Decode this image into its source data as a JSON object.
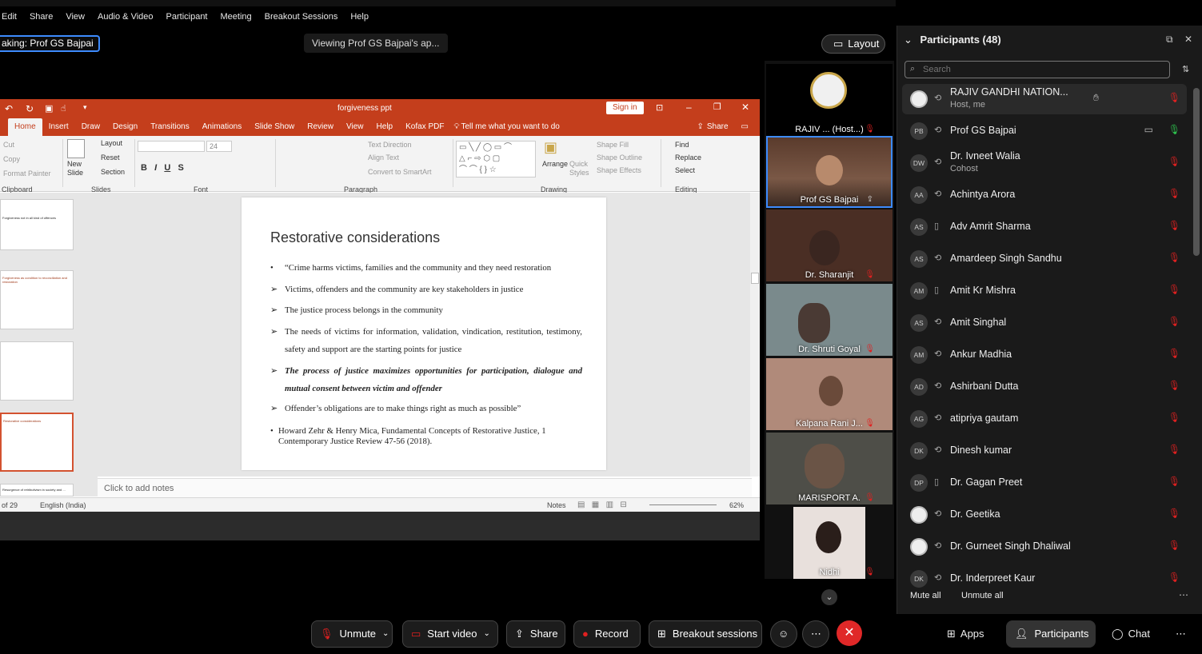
{
  "menubar": [
    "Edit",
    "Share",
    "View",
    "Audio & Video",
    "Participant",
    "Meeting",
    "Breakout Sessions",
    "Help"
  ],
  "speaking_label": "aking: Prof GS Bajpai",
  "viewing_label": "Viewing Prof GS Bajpai's ap...",
  "layout_label": "Layout",
  "ppt": {
    "file_title": "forgiveness ppt",
    "sign_in": "Sign in",
    "tabs": [
      "Home",
      "Insert",
      "Draw",
      "Design",
      "Transitions",
      "Animations",
      "Slide Show",
      "Review",
      "View",
      "Help",
      "Kofax PDF"
    ],
    "tell_me": "Tell me what you want to do",
    "share": "Share",
    "ribbon": {
      "cut": "Cut",
      "copy": "Copy",
      "format_painter": "Format Painter",
      "new_slide": "New Slide",
      "layout": "Layout",
      "reset": "Reset",
      "section": "Section",
      "font_size": "24",
      "text_direction": "Text Direction",
      "align_text": "Align Text",
      "convert": "Convert to SmartArt",
      "arrange": "Arrange",
      "quick_styles": "Quick Styles",
      "shape_fill": "Shape Fill",
      "shape_outline": "Shape Outline",
      "shape_effects": "Shape Effects",
      "find": "Find",
      "replace": "Replace",
      "select": "Select",
      "groups": [
        "Clipboard",
        "Slides",
        "Font",
        "Paragraph",
        "Drawing",
        "Editing"
      ]
    },
    "thumb_texts": [
      "Forgiveness not in all kind of offences",
      "Forgiveness as condition to reconciliation and restoration",
      "Restorative considerations",
      "Resurgence of retributivism in society and ..."
    ],
    "slide": {
      "title": "Restorative considerations",
      "bullets": [
        {
          "marker": "•",
          "text": "“Crime harms victims, families and the community and they need restoration",
          "style": "normal"
        },
        {
          "marker": "➢",
          "text": "Victims, offenders and the community are key stakeholders in justice",
          "style": "normal"
        },
        {
          "marker": "➢",
          "text": "The justice process belongs in the community",
          "style": "normal"
        },
        {
          "marker": "➢",
          "text": "The needs of victims for information, validation, vindication, restitution, testimony, safety and support are the starting points for justice",
          "style": "normal"
        },
        {
          "marker": "➢",
          "text": "The process of justice maximizes opportunities for participation, dialogue and mutual consent between victim and offender",
          "style": "bold-italic"
        },
        {
          "marker": "➢",
          "text": "Offender’s obligations are to make things right as much as possible”",
          "style": "normal"
        }
      ],
      "citation": "Howard Zehr & Henry Mica, Fundamental Concepts of Restorative Justice, 1 Contemporary Justice Review 47-56 (2018)."
    },
    "notes_placeholder": "Click to add notes",
    "status": {
      "slide_count": "of 29",
      "language": "English (India)",
      "notes": "Notes",
      "zoom": "62%"
    }
  },
  "videos": [
    {
      "name": "RAJIV ... (Host...)",
      "mic": "muted",
      "active": false,
      "kind": "logo"
    },
    {
      "name": "Prof GS Bajpai",
      "mic": "sharing",
      "active": true,
      "kind": "person"
    },
    {
      "name": "Dr. Sharanjit",
      "mic": "muted",
      "active": false,
      "kind": "person"
    },
    {
      "name": "Dr. Shruti Goyal",
      "mic": "muted",
      "active": false,
      "kind": "person"
    },
    {
      "name": "Kalpana Rani J...",
      "mic": "muted",
      "active": false,
      "kind": "person"
    },
    {
      "name": "MARISPORT A.",
      "mic": "muted",
      "active": false,
      "kind": "person"
    },
    {
      "name": "Nidhi",
      "mic": "muted",
      "active": false,
      "kind": "person"
    }
  ],
  "panel": {
    "title": "Participants (48)",
    "search_placeholder": "Search",
    "participants": [
      {
        "initials": "",
        "name": "RAJIV GANDHI NATION...",
        "role": "Host, me",
        "icon": "sync",
        "mic": "muted",
        "avatar_img": true,
        "hand": true
      },
      {
        "initials": "PB",
        "name": "Prof GS Bajpai",
        "role": "",
        "icon": "sync",
        "mic": "on",
        "camera": true
      },
      {
        "initials": "DW",
        "name": "Dr. Ivneet Walia",
        "role": "Cohost",
        "icon": "sync",
        "mic": "muted"
      },
      {
        "initials": "AA",
        "name": "Achintya Arora",
        "role": "",
        "icon": "sync",
        "mic": "muted"
      },
      {
        "initials": "AS",
        "name": "Adv Amrit Sharma",
        "role": "",
        "icon": "phone",
        "mic": "muted"
      },
      {
        "initials": "AS",
        "name": "Amardeep Singh Sandhu",
        "role": "",
        "icon": "sync",
        "mic": "muted"
      },
      {
        "initials": "AM",
        "name": "Amit Kr Mishra",
        "role": "",
        "icon": "phone",
        "mic": "muted"
      },
      {
        "initials": "AS",
        "name": "Amit Singhal",
        "role": "",
        "icon": "sync",
        "mic": "muted"
      },
      {
        "initials": "AM",
        "name": "Ankur Madhia",
        "role": "",
        "icon": "sync",
        "mic": "muted"
      },
      {
        "initials": "AD",
        "name": "Ashirbani Dutta",
        "role": "",
        "icon": "sync",
        "mic": "muted"
      },
      {
        "initials": "AG",
        "name": "atipriya gautam",
        "role": "",
        "icon": "sync",
        "mic": "muted"
      },
      {
        "initials": "DK",
        "name": "Dinesh kumar",
        "role": "",
        "icon": "sync",
        "mic": "muted"
      },
      {
        "initials": "DP",
        "name": "Dr. Gagan Preet",
        "role": "",
        "icon": "phone",
        "mic": "muted"
      },
      {
        "initials": "",
        "name": "Dr. Geetika",
        "role": "",
        "icon": "sync",
        "mic": "muted",
        "avatar_img": true
      },
      {
        "initials": "",
        "name": "Dr. Gurneet Singh Dhaliwal",
        "role": "",
        "icon": "sync",
        "mic": "muted",
        "avatar_img": true
      },
      {
        "initials": "DK",
        "name": "Dr. Inderpreet Kaur",
        "role": "",
        "icon": "sync",
        "mic": "muted"
      }
    ],
    "mute_all": "Mute all",
    "unmute_all": "Unmute all"
  },
  "toolbar": {
    "unmute": "Unmute",
    "start_video": "Start video",
    "share": "Share",
    "record": "Record",
    "breakout": "Breakout sessions",
    "apps": "Apps",
    "participants": "Participants",
    "chat": "Chat"
  },
  "colors": {
    "ppt_red": "#c43e1c",
    "muted_red": "#e02020",
    "active_blue": "#3d8bfd",
    "end_red": "#e02828"
  }
}
